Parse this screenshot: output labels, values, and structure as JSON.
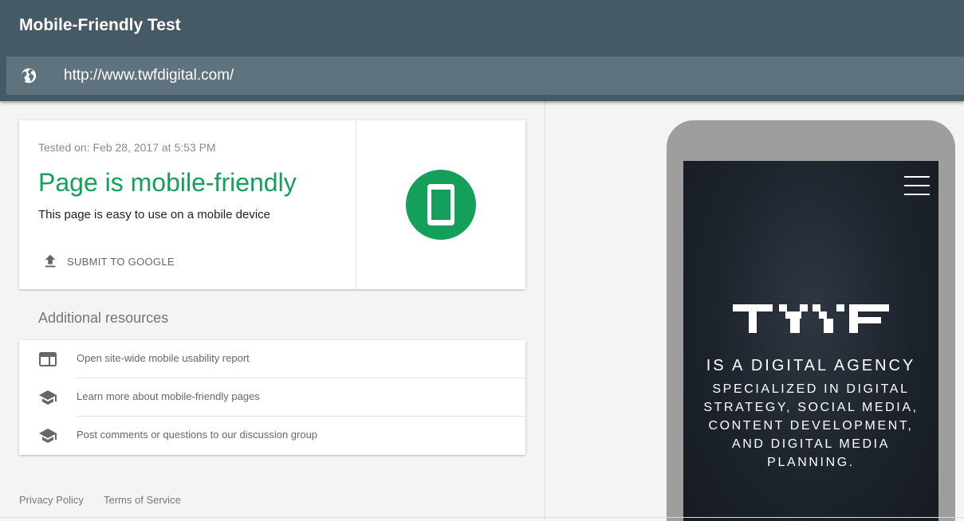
{
  "header": {
    "title": "Mobile-Friendly Test",
    "url": "http://www.twfdigital.com/"
  },
  "result": {
    "tested_on": "Tested on: Feb 28, 2017 at 5:53 PM",
    "verdict": "Page is mobile-friendly",
    "verdict_sub": "This page is easy to use on a mobile device",
    "submit_label": "SUBMIT TO GOOGLE",
    "accent": "#14a05a"
  },
  "resources": {
    "heading": "Additional resources",
    "items": [
      {
        "icon": "web-layout-icon",
        "label": "Open site-wide mobile usability report"
      },
      {
        "icon": "school-icon",
        "label": "Learn more about mobile-friendly pages"
      },
      {
        "icon": "school-icon",
        "label": "Post comments or questions to our discussion group"
      }
    ]
  },
  "footer": {
    "privacy": "Privacy Policy",
    "terms": "Terms of Service"
  },
  "preview": {
    "tagline_main": "IS A DIGITAL AGENCY",
    "tagline_lines": [
      "SPECIALIZED IN DIGITAL",
      "STRATEGY, SOCIAL MEDIA,",
      "CONTENT DEVELOPMENT,",
      "AND DIGITAL MEDIA",
      "PLANNING."
    ]
  },
  "colors": {
    "header": "#455a64",
    "url_bar": "#5f737e",
    "success": "#14a05a"
  }
}
